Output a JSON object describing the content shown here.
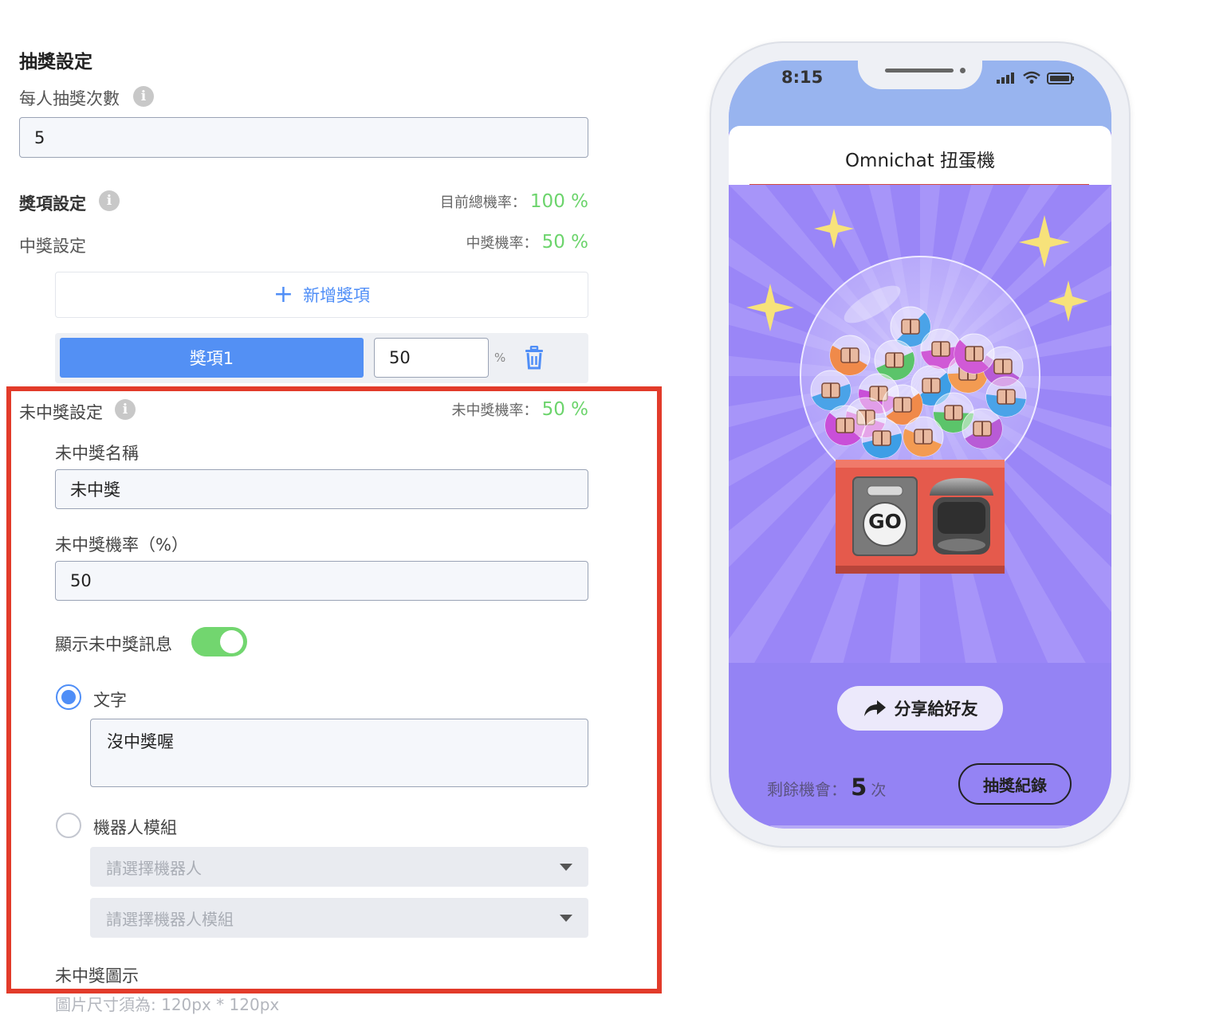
{
  "settings": {
    "title": "抽獎設定",
    "draws_label": "每人抽獎次數",
    "draws_value": "5",
    "prize_settings_label": "獎項設定",
    "total_rate_label": "目前總機率：",
    "total_rate_value": "100 %",
    "win_settings_label": "中獎設定",
    "win_rate_label": "中獎機率：",
    "win_rate_value": "50 %",
    "add_prize_label": "新增獎項",
    "prizes": [
      {
        "name": "獎項1",
        "rate": "50",
        "unit": "%"
      }
    ]
  },
  "lose": {
    "section_label": "未中獎設定",
    "rate_label": "未中獎機率：",
    "rate_value": "50 %",
    "name_label": "未中獎名稱",
    "name_value": "未中獎",
    "prob_label": "未中獎機率（%）",
    "prob_value": "50",
    "show_msg_label": "顯示未中獎訊息",
    "show_msg_enabled": true,
    "option_text_label": "文字",
    "option_text_selected": true,
    "message_value": "沒中獎喔",
    "option_bot_label": "機器人模組",
    "bot_placeholder": "請選擇機器人",
    "bot_module_placeholder": "請選擇機器人模組",
    "icon_label": "未中獎圖示",
    "icon_hint": "圖片尺寸須為: 120px * 120px"
  },
  "phone": {
    "time": "8:15",
    "title": "Omnichat 扭蛋機",
    "go_label": "GO",
    "share_label": "分享給好友",
    "remaining_label": "剩餘機會：",
    "remaining_value": "5",
    "remaining_unit": "次",
    "history_label": "抽獎紀錄"
  },
  "colors": {
    "accent_blue": "#4f8ef7",
    "rate_green": "#6cd46c",
    "highlight_red": "#e23b2a",
    "phone_bg": "#9483f4",
    "phone_header": "#98b4ef",
    "toggle_green": "#72d66f"
  }
}
